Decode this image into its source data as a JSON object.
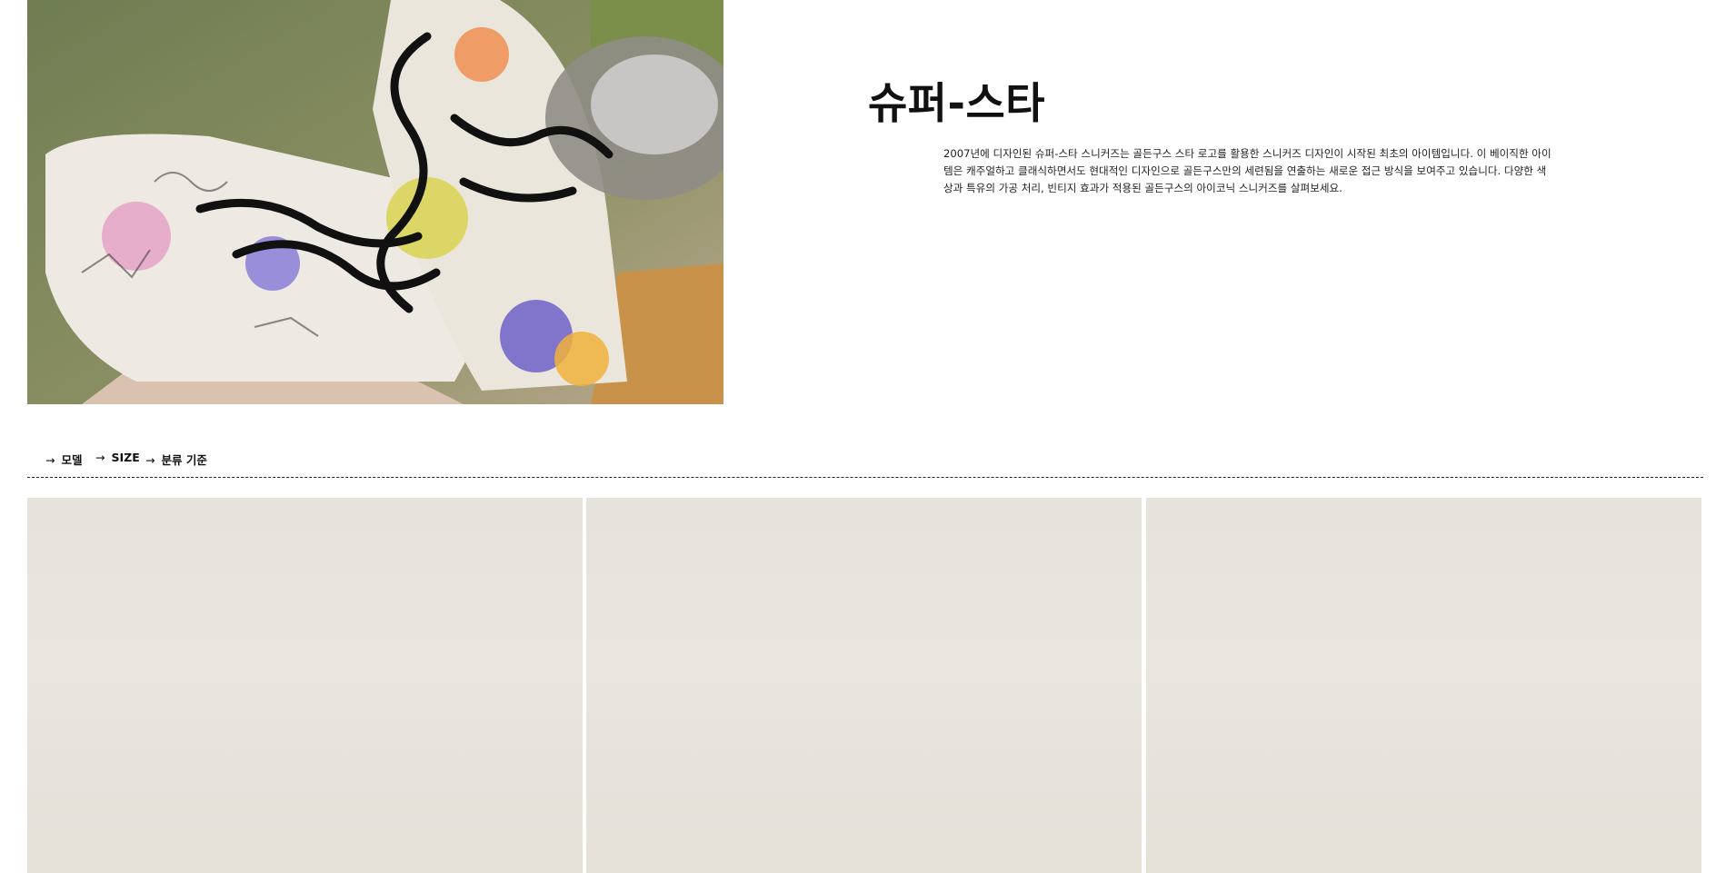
{
  "hero": {
    "title": "슈퍼-스타",
    "description": "2007년에 디자인된 슈퍼-스타 스니커즈는 골든구스 스타 로고를 활용한 스니커즈 디자인이 시작된 최초의 아이템입니다. 이 베이직한 아이템은 캐주얼하고 클래식하면서도 현대적인 디자인으로 골든구스만의 세련됨을 연출하는 새로운 접근 방식을 보여주고 있습니다. 다양한 색상과 특유의 가공 처리, 빈티지 효과가 적용된 골든구스의 아이코닉 스니커즈를 살펴보세요.",
    "image_subject": "graffiti-sneakers-photo"
  },
  "filters": {
    "arrow": "→",
    "items": [
      "모델",
      "SIZE",
      "분류 기준"
    ]
  },
  "products": {
    "count_visible": 3
  }
}
